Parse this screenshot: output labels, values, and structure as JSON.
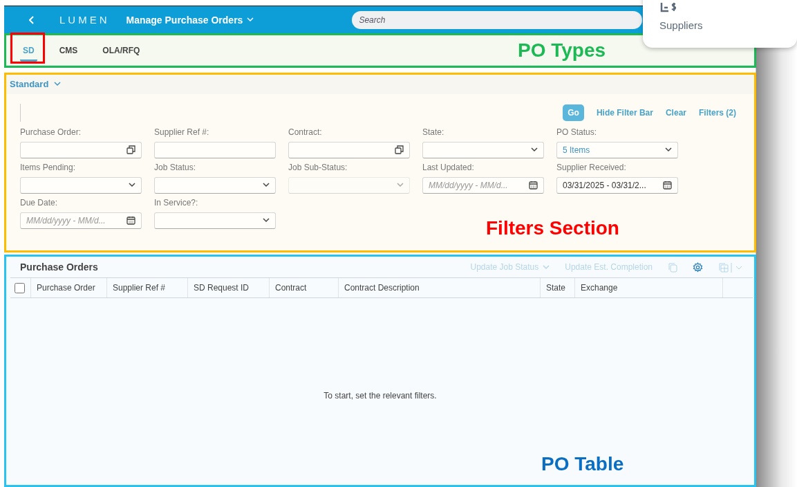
{
  "shell": {
    "brand": "LUMEN",
    "title": "Manage Purchase Orders",
    "search": {
      "placeholder": "Search"
    }
  },
  "popup": {
    "label": "Suppliers"
  },
  "tabs": {
    "annotation": {
      "label": "PO Types",
      "color": "#1db954"
    },
    "items": [
      {
        "label": "SD",
        "selected": true,
        "marked": true
      },
      {
        "label": "CMS",
        "selected": false,
        "marked": false
      },
      {
        "label": "OLA/RFQ",
        "selected": false,
        "marked": false
      }
    ]
  },
  "filters": {
    "annotation": {
      "label": "Filters Section",
      "color": "#ffbb00",
      "label_style": {
        "color": "#ff0000"
      }
    },
    "variant": "Standard",
    "actions": [
      {
        "label": "Go",
        "kind": "primary"
      },
      {
        "label": "Hide Filter Bar",
        "kind": "link"
      },
      {
        "label": "Clear",
        "kind": "link"
      },
      {
        "label": "Filters (2)",
        "kind": "link"
      }
    ],
    "fields": [
      {
        "label": "Purchase Order:",
        "kind": "valuehelp",
        "disabled": false
      },
      {
        "label": "Supplier Ref #:",
        "kind": "text",
        "disabled": false
      },
      {
        "label": "Contract:",
        "kind": "valuehelp",
        "disabled": false
      },
      {
        "label": "State:",
        "kind": "select",
        "disabled": false
      },
      {
        "label": "PO Status:",
        "kind": "select",
        "value": "5 Items",
        "disabled": false
      },
      {
        "label": "Items Pending:",
        "kind": "select",
        "disabled": false
      },
      {
        "label": "Job Status:",
        "kind": "select",
        "disabled": false
      },
      {
        "label": "Job Sub-Status:",
        "kind": "select",
        "disabled": true
      },
      {
        "label": "Last Updated:",
        "kind": "date",
        "placeholder": "MM/dd/yyyy - MM/d...",
        "disabled": false
      },
      {
        "label": "Supplier Received:",
        "kind": "date",
        "value": "03/31/2025 - 03/31/2...",
        "disabled": false
      },
      {
        "label": "Due Date:",
        "kind": "date",
        "placeholder": "MM/dd/yyyy - MM/d...",
        "disabled": false
      },
      {
        "label": "In Service?:",
        "kind": "select",
        "disabled": false
      }
    ]
  },
  "table": {
    "annotation": {
      "label": "PO Table",
      "color": "#29c3f0",
      "label_style": {
        "color": "#0a6fc2"
      }
    },
    "title": "Purchase Orders",
    "toolbar": [
      {
        "label": "Update Job Status",
        "kind": "menu",
        "disabled": true
      },
      {
        "label": "Update Est. Completion",
        "kind": "button",
        "disabled": true
      }
    ],
    "select_all": {
      "checked": false
    },
    "columns": [
      "Purchase Order",
      "Supplier Ref #",
      "SD Request ID",
      "Contract",
      "Contract Description",
      "State",
      "Exchange"
    ],
    "empty_text": "To start, set the relevant filters."
  }
}
